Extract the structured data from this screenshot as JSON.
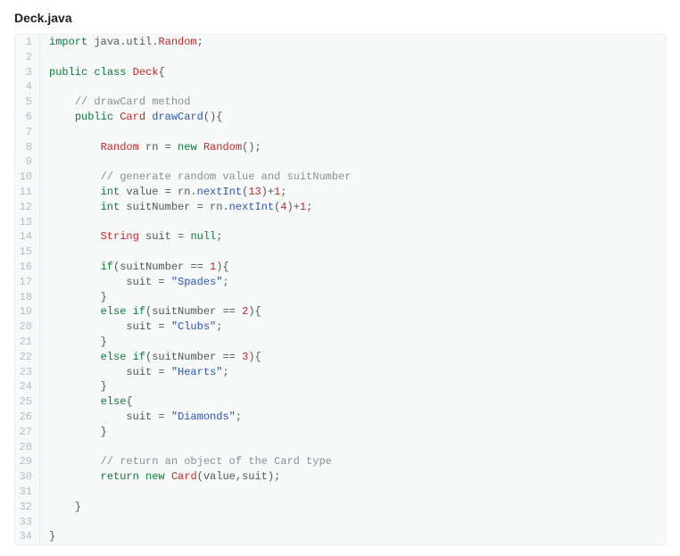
{
  "title": "Deck.java",
  "code": [
    {
      "n": "1",
      "frags": [
        {
          "t": "import",
          "c": "kw"
        },
        {
          "t": " java.util.",
          "c": "op"
        },
        {
          "t": "Random",
          "c": "typ"
        },
        {
          "t": ";",
          "c": "op"
        }
      ]
    },
    {
      "n": "2",
      "frags": []
    },
    {
      "n": "3",
      "frags": [
        {
          "t": "public",
          "c": "kw"
        },
        {
          "t": " ",
          "c": "op"
        },
        {
          "t": "class",
          "c": "kw"
        },
        {
          "t": " ",
          "c": "op"
        },
        {
          "t": "Deck",
          "c": "typ"
        },
        {
          "t": "{",
          "c": "op"
        }
      ]
    },
    {
      "n": "4",
      "frags": []
    },
    {
      "n": "5",
      "frags": [
        {
          "t": "    ",
          "c": "op"
        },
        {
          "t": "// drawCard method",
          "c": "cmt"
        }
      ]
    },
    {
      "n": "6",
      "frags": [
        {
          "t": "    ",
          "c": "op"
        },
        {
          "t": "public",
          "c": "kw"
        },
        {
          "t": " ",
          "c": "op"
        },
        {
          "t": "Card",
          "c": "typ"
        },
        {
          "t": " ",
          "c": "op"
        },
        {
          "t": "drawCard",
          "c": "fn"
        },
        {
          "t": "(){",
          "c": "op"
        }
      ]
    },
    {
      "n": "7",
      "frags": []
    },
    {
      "n": "8",
      "frags": [
        {
          "t": "        ",
          "c": "op"
        },
        {
          "t": "Random",
          "c": "typ"
        },
        {
          "t": " rn = ",
          "c": "op"
        },
        {
          "t": "new",
          "c": "kw"
        },
        {
          "t": " ",
          "c": "op"
        },
        {
          "t": "Random",
          "c": "typ"
        },
        {
          "t": "();",
          "c": "op"
        }
      ]
    },
    {
      "n": "9",
      "frags": []
    },
    {
      "n": "10",
      "frags": [
        {
          "t": "        ",
          "c": "op"
        },
        {
          "t": "// generate random value and suitNumber",
          "c": "cmt"
        }
      ]
    },
    {
      "n": "11",
      "frags": [
        {
          "t": "        ",
          "c": "op"
        },
        {
          "t": "int",
          "c": "pkw"
        },
        {
          "t": " value = rn.",
          "c": "op"
        },
        {
          "t": "nextInt",
          "c": "fn"
        },
        {
          "t": "(",
          "c": "op"
        },
        {
          "t": "13",
          "c": "num"
        },
        {
          "t": ")+",
          "c": "op"
        },
        {
          "t": "1",
          "c": "num"
        },
        {
          "t": ";",
          "c": "op"
        }
      ]
    },
    {
      "n": "12",
      "frags": [
        {
          "t": "        ",
          "c": "op"
        },
        {
          "t": "int",
          "c": "pkw"
        },
        {
          "t": " suitNumber = rn.",
          "c": "op"
        },
        {
          "t": "nextInt",
          "c": "fn"
        },
        {
          "t": "(",
          "c": "op"
        },
        {
          "t": "4",
          "c": "num"
        },
        {
          "t": ")+",
          "c": "op"
        },
        {
          "t": "1",
          "c": "num"
        },
        {
          "t": ";",
          "c": "op"
        }
      ]
    },
    {
      "n": "13",
      "frags": []
    },
    {
      "n": "14",
      "frags": [
        {
          "t": "        ",
          "c": "op"
        },
        {
          "t": "String",
          "c": "typ"
        },
        {
          "t": " suit = ",
          "c": "op"
        },
        {
          "t": "null",
          "c": "pkw"
        },
        {
          "t": ";",
          "c": "op"
        }
      ]
    },
    {
      "n": "15",
      "frags": []
    },
    {
      "n": "16",
      "frags": [
        {
          "t": "        ",
          "c": "op"
        },
        {
          "t": "if",
          "c": "kw"
        },
        {
          "t": "(suitNumber == ",
          "c": "op"
        },
        {
          "t": "1",
          "c": "num"
        },
        {
          "t": "){",
          "c": "op"
        }
      ]
    },
    {
      "n": "17",
      "frags": [
        {
          "t": "            suit = ",
          "c": "op"
        },
        {
          "t": "\"Spades\"",
          "c": "str"
        },
        {
          "t": ";",
          "c": "op"
        }
      ]
    },
    {
      "n": "18",
      "frags": [
        {
          "t": "        }",
          "c": "op"
        }
      ]
    },
    {
      "n": "19",
      "frags": [
        {
          "t": "        ",
          "c": "op"
        },
        {
          "t": "else",
          "c": "kw"
        },
        {
          "t": " ",
          "c": "op"
        },
        {
          "t": "if",
          "c": "kw"
        },
        {
          "t": "(suitNumber == ",
          "c": "op"
        },
        {
          "t": "2",
          "c": "num"
        },
        {
          "t": "){",
          "c": "op"
        }
      ]
    },
    {
      "n": "20",
      "frags": [
        {
          "t": "            suit = ",
          "c": "op"
        },
        {
          "t": "\"Clubs\"",
          "c": "str"
        },
        {
          "t": ";",
          "c": "op"
        }
      ]
    },
    {
      "n": "21",
      "frags": [
        {
          "t": "        }",
          "c": "op"
        }
      ]
    },
    {
      "n": "22",
      "frags": [
        {
          "t": "        ",
          "c": "op"
        },
        {
          "t": "else",
          "c": "kw"
        },
        {
          "t": " ",
          "c": "op"
        },
        {
          "t": "if",
          "c": "kw"
        },
        {
          "t": "(suitNumber == ",
          "c": "op"
        },
        {
          "t": "3",
          "c": "num"
        },
        {
          "t": "){",
          "c": "op"
        }
      ]
    },
    {
      "n": "23",
      "frags": [
        {
          "t": "            suit = ",
          "c": "op"
        },
        {
          "t": "\"Hearts\"",
          "c": "str"
        },
        {
          "t": ";",
          "c": "op"
        }
      ]
    },
    {
      "n": "24",
      "frags": [
        {
          "t": "        }",
          "c": "op"
        }
      ]
    },
    {
      "n": "25",
      "frags": [
        {
          "t": "        ",
          "c": "op"
        },
        {
          "t": "else",
          "c": "kw"
        },
        {
          "t": "{",
          "c": "op"
        }
      ]
    },
    {
      "n": "26",
      "frags": [
        {
          "t": "            suit = ",
          "c": "op"
        },
        {
          "t": "\"Diamonds\"",
          "c": "str"
        },
        {
          "t": ";",
          "c": "op"
        }
      ]
    },
    {
      "n": "27",
      "frags": [
        {
          "t": "        }",
          "c": "op"
        }
      ]
    },
    {
      "n": "28",
      "frags": []
    },
    {
      "n": "29",
      "frags": [
        {
          "t": "        ",
          "c": "op"
        },
        {
          "t": "// return an object of the Card type",
          "c": "cmt"
        }
      ]
    },
    {
      "n": "30",
      "frags": [
        {
          "t": "        ",
          "c": "op"
        },
        {
          "t": "return",
          "c": "kw"
        },
        {
          "t": " ",
          "c": "op"
        },
        {
          "t": "new",
          "c": "kw"
        },
        {
          "t": " ",
          "c": "op"
        },
        {
          "t": "Card",
          "c": "typ"
        },
        {
          "t": "(value,suit);",
          "c": "op"
        }
      ]
    },
    {
      "n": "31",
      "frags": []
    },
    {
      "n": "32",
      "frags": [
        {
          "t": "    }",
          "c": "op"
        }
      ]
    },
    {
      "n": "33",
      "frags": []
    },
    {
      "n": "34",
      "frags": [
        {
          "t": "}",
          "c": "op"
        }
      ]
    }
  ]
}
